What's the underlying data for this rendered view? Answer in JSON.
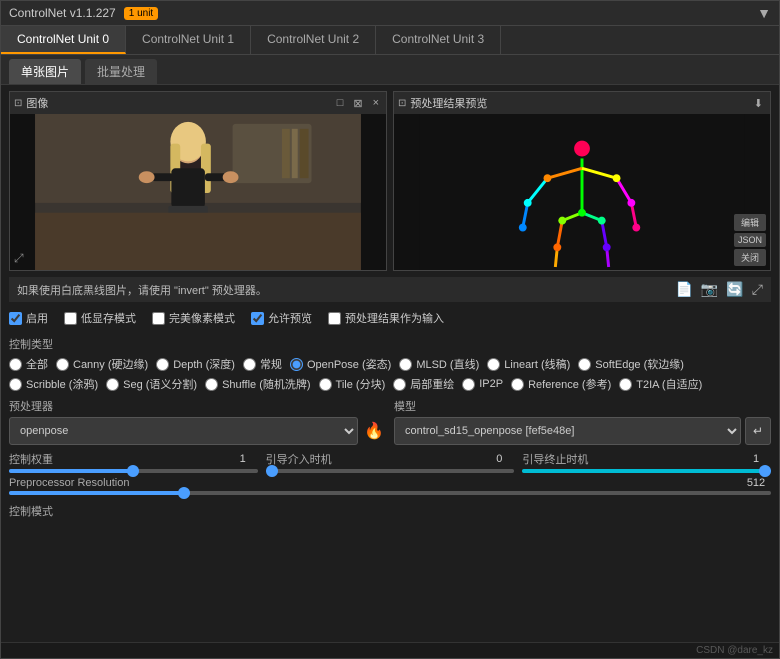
{
  "title": "ControlNet v1.1.227",
  "badge": "1 unit",
  "tabs": [
    {
      "label": "ControlNet Unit 0",
      "active": true
    },
    {
      "label": "ControlNet Unit 1",
      "active": false
    },
    {
      "label": "ControlNet Unit 2",
      "active": false
    },
    {
      "label": "ControlNet Unit 3",
      "active": false
    }
  ],
  "sub_tabs": [
    {
      "label": "单张图片",
      "active": true
    },
    {
      "label": "批量处理",
      "active": false
    }
  ],
  "image_panel": {
    "title": "图像",
    "btns": [
      "□",
      "⊠",
      "×",
      "⤢"
    ]
  },
  "preview_panel": {
    "title": "预处理结果预览",
    "btns": [
      "编辑",
      "JSON",
      "关闭"
    ]
  },
  "info_text": "如果使用白底黑线图片，请使用 \"invert\" 预处理器。",
  "checkboxes": [
    {
      "label": "启用",
      "checked": true
    },
    {
      "label": "低显存模式",
      "checked": false
    },
    {
      "label": "完美像素模式",
      "checked": false
    },
    {
      "label": "允许预览",
      "checked": true
    },
    {
      "label": "预处理结果作为输入",
      "checked": false
    }
  ],
  "control_type_label": "控制类型",
  "radio_options": [
    {
      "label": "全部",
      "checked": false
    },
    {
      "label": "Canny (硬边缘)",
      "checked": false
    },
    {
      "label": "Depth (深度)",
      "checked": false
    },
    {
      "label": "常规",
      "checked": false
    },
    {
      "label": "OpenPose (姿态)",
      "checked": true
    },
    {
      "label": "MLSD (直线)",
      "checked": false
    },
    {
      "label": "Lineart (线稿)",
      "checked": false
    },
    {
      "label": "SoftEdge (软边缘)",
      "checked": false
    },
    {
      "label": "Scribble (涂鸦)",
      "checked": false
    },
    {
      "label": "Seg (语义分割)",
      "checked": false
    },
    {
      "label": "Shuffle (随机洗牌)",
      "checked": false
    },
    {
      "label": "Tile (分块)",
      "checked": false
    },
    {
      "label": "局部重绘",
      "checked": false
    },
    {
      "label": "IP2P",
      "checked": false
    },
    {
      "label": "Reference (参考)",
      "checked": false
    },
    {
      "label": "T2IA (自适应)",
      "checked": false
    }
  ],
  "preprocessor_label": "预处理器",
  "preprocessor_value": "openpose",
  "model_label": "模型",
  "model_value": "control_sd15_openpose [fef5e48e]",
  "sliders": {
    "control_weight": {
      "label": "控制权重",
      "value": 1,
      "min": 0,
      "max": 2,
      "percent": 50
    },
    "start_time": {
      "label": "引导介入时机",
      "value": 0,
      "min": 0,
      "max": 1,
      "percent": 0
    },
    "end_time": {
      "label": "引导终止时机",
      "value": 1,
      "min": 0,
      "max": 1,
      "percent": 100
    },
    "preprocessor_res": {
      "label": "Preprocessor Resolution",
      "value": 512,
      "min": 64,
      "max": 2048,
      "percent": 25
    }
  },
  "control_mode_label": "控制模式",
  "watermark": "CSDN @dare_kz"
}
